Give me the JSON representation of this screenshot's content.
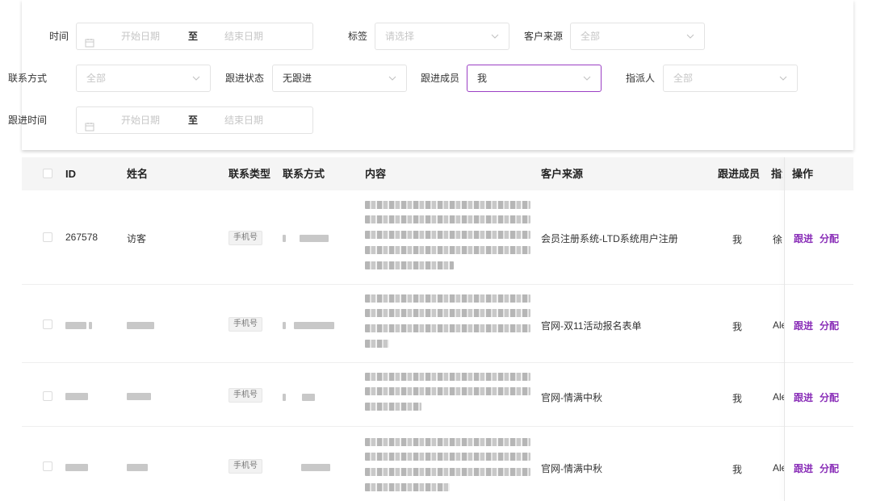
{
  "filters": {
    "time": {
      "label": "时间",
      "start_placeholder": "开始日期",
      "separator": "至",
      "end_placeholder": "结束日期"
    },
    "tag": {
      "label": "标签",
      "placeholder": "请选择"
    },
    "customer_source": {
      "label": "客户来源",
      "placeholder": "全部"
    },
    "contact_method": {
      "label": "联系方式",
      "placeholder": "全部"
    },
    "follow_status": {
      "label": "跟进状态",
      "value": "无跟进"
    },
    "follow_member": {
      "label": "跟进成员",
      "value": "我"
    },
    "assigner": {
      "label": "指派人",
      "placeholder": "全部"
    },
    "follow_time": {
      "label": "跟进时间",
      "start_placeholder": "开始日期",
      "separator": "至",
      "end_placeholder": "结束日期"
    }
  },
  "table": {
    "columns": {
      "id": "ID",
      "name": "姓名",
      "contact_type": "联系类型",
      "contact": "联系方式",
      "content": "内容",
      "source": "客户来源",
      "member": "跟进成员",
      "assigner": "指派",
      "ops": "操作"
    },
    "rows": [
      {
        "id": "267578",
        "name": "访客",
        "contact_type": "手机号",
        "source": "会员注册系统-LTD系统用户注册",
        "member": "我",
        "assigner": "徐",
        "action_follow": "跟进",
        "action_assign": "分配"
      },
      {
        "id": "",
        "name": "",
        "contact_type": "手机号",
        "source": "官网-双11活动报名表单",
        "member": "我",
        "assigner": "Ale",
        "action_follow": "跟进",
        "action_assign": "分配"
      },
      {
        "id": "",
        "name": "",
        "contact_type": "手机号",
        "source": "官网-情满中秋",
        "member": "我",
        "assigner": "Ale",
        "action_follow": "跟进",
        "action_assign": "分配"
      },
      {
        "id": "",
        "name": "",
        "contact_type": "手机号",
        "source": "官网-情满中秋",
        "member": "我",
        "assigner": "Ale",
        "action_follow": "跟进",
        "action_assign": "分配"
      }
    ]
  },
  "colors": {
    "accent": "#8a2fb8",
    "focus_border": "#9b3fc4",
    "header_bg": "#f5f5f5"
  },
  "icons": {
    "date": "calendar-icon",
    "select": "chevron-down-icon"
  }
}
